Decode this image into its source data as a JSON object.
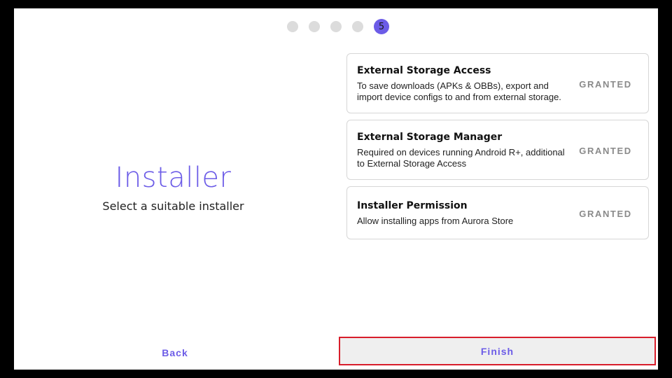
{
  "stepper": {
    "total": 5,
    "current": 5,
    "current_label": "5"
  },
  "intro": {
    "title": "Installer",
    "subtitle": "Select a suitable installer"
  },
  "permissions": [
    {
      "title": "External Storage Access",
      "description": "To save downloads (APKs & OBBs), export and import device configs to and from external storage.",
      "status": "GRANTED"
    },
    {
      "title": "External Storage Manager",
      "description": "Required on devices running Android R+, additional to External Storage Access",
      "status": "GRANTED"
    },
    {
      "title": "Installer Permission",
      "description": "Allow installing apps from Aurora Store",
      "status": "GRANTED"
    }
  ],
  "actions": {
    "back_label": "Back",
    "finish_label": "Finish"
  },
  "colors": {
    "accent": "#6c5ce7",
    "highlight_border": "#d81e2b"
  }
}
